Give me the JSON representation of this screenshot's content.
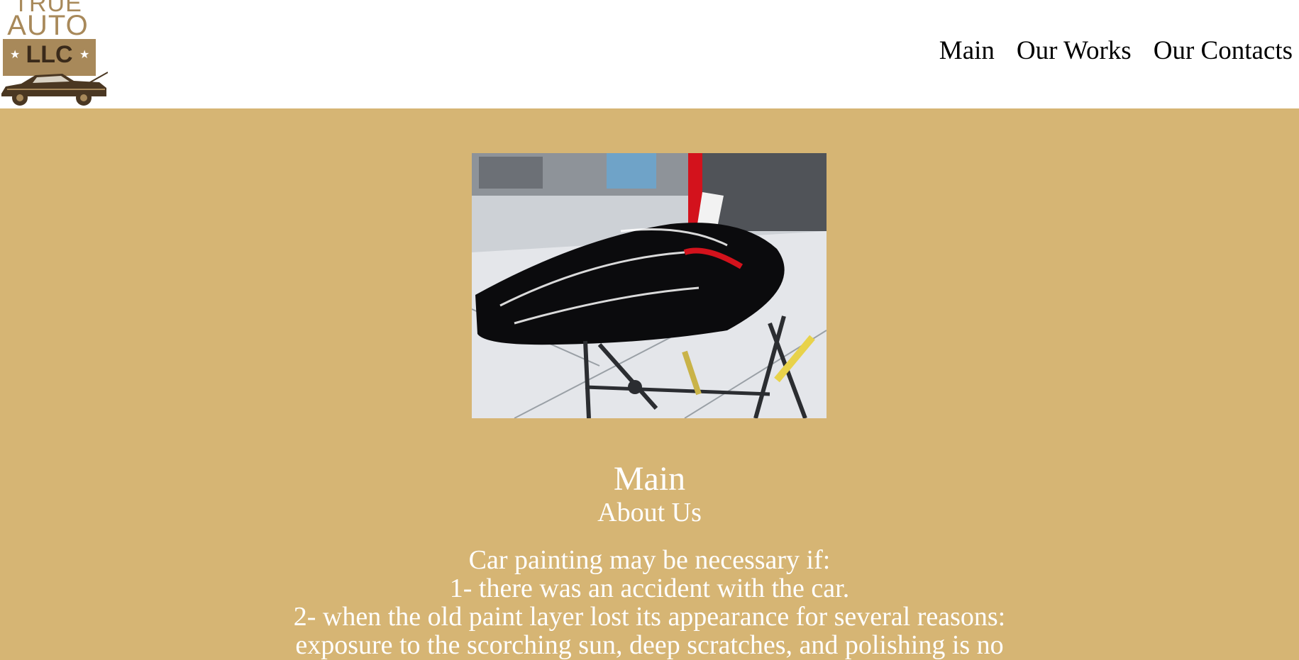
{
  "header": {
    "logo": {
      "line1": "TRUE",
      "line2": "AUTO",
      "badge": "LLC",
      "star_glyph": "★",
      "car_icon": "classic-car-icon"
    },
    "nav": {
      "items": [
        {
          "label": "Main"
        },
        {
          "label": "Our Works"
        },
        {
          "label": "Our Contacts"
        }
      ]
    }
  },
  "hero": {
    "image": "car-hood-painting-photo"
  },
  "main": {
    "title": "Main",
    "subtitle": "About Us",
    "paragraph_lines": [
      "Car painting may be necessary if:",
      "1- there was an accident with the car.",
      "2- when the old paint layer lost its appearance for several reasons:",
      "exposure to the scorching sun, deep scratches, and polishing is no"
    ]
  },
  "colors": {
    "background": "#d6b574",
    "header": "#ffffff",
    "logo_gold": "#a8895a",
    "text": "#ffffff",
    "nav_text": "#000000"
  }
}
